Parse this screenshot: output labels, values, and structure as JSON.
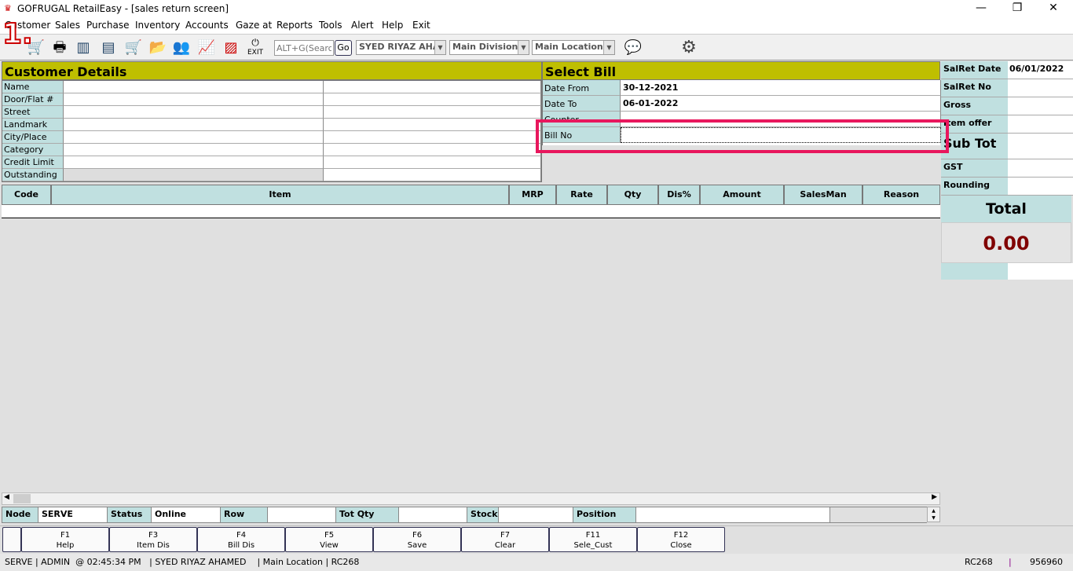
{
  "window": {
    "title": "GOFRUGAL RetailEasy - [sales return screen]",
    "minimize": "—",
    "restore": "❐",
    "close": "✕"
  },
  "menu": [
    "Customer",
    "Sales",
    "Purchase",
    "Inventory",
    "Accounts",
    "Gaze at",
    "Reports",
    "Tools",
    "Alert",
    "Help",
    "Exit"
  ],
  "annotation": "1.",
  "toolbar": {
    "search_placeholder": "ALT+G(Search",
    "go_label": "Go",
    "user": "SYED RIYAZ AHAMED",
    "division": "Main Division",
    "location": "Main Location",
    "exit_label": "EXIT"
  },
  "customer": {
    "title": "Customer Details",
    "fields": [
      "Name",
      "Door/Flat #",
      "Street",
      "Landmark",
      "City/Place",
      "Category",
      "Credit Limit",
      "Outstanding"
    ]
  },
  "select_bill": {
    "title": "Select Bill",
    "fields": [
      {
        "label": "Date From",
        "value": "30-12-2021"
      },
      {
        "label": "Date To",
        "value": "06-01-2022"
      },
      {
        "label": "Counter",
        "value": ""
      },
      {
        "label": "Bill No",
        "value": ""
      }
    ]
  },
  "summary": {
    "salret_date_label": "SalRet Date",
    "salret_date": "06/01/2022",
    "salret_no_label": "SalRet No",
    "gross_label": "Gross",
    "item_offer_label": "Item offer",
    "sub_tot_label": "Sub Tot",
    "gst_label": "GST",
    "rounding_label": "Rounding",
    "total_label": "Total",
    "total_value": "0.00"
  },
  "grid": {
    "columns": [
      "Code",
      "Item",
      "MRP",
      "Rate",
      "Qty",
      "Dis%",
      "Amount",
      "SalesMan",
      "Reason"
    ]
  },
  "status": {
    "node_label": "Node",
    "node": "SERVE",
    "status_label": "Status",
    "status": "Online",
    "row_label": "Row",
    "row": "",
    "totqty_label": "Tot Qty",
    "totqty": "",
    "stock_label": "Stock",
    "stock": "",
    "position_label": "Position",
    "position": ""
  },
  "fkeys": [
    {
      "key": "F1",
      "label": "Help"
    },
    {
      "key": "F3",
      "label": "Item Dis"
    },
    {
      "key": "F4",
      "label": "Bill Dis"
    },
    {
      "key": "F5",
      "label": "View"
    },
    {
      "key": "F6",
      "label": "Save"
    },
    {
      "key": "F7",
      "label": "Clear"
    },
    {
      "key": "F11",
      "label": "Sele_Cust"
    },
    {
      "key": "F12",
      "label": "Close"
    }
  ],
  "bottom": {
    "left": "SERVE | ADMIN  @ 02:45:34 PM   | SYED RIYAZ AHAMED    | Main Location | RC268",
    "code": "RC268",
    "sep": "|",
    "number": "956960"
  },
  "colors": {
    "header": "#bfbf00",
    "label_bg": "#c0e0e0",
    "total": "#800000",
    "highlight": "#e8175d"
  }
}
